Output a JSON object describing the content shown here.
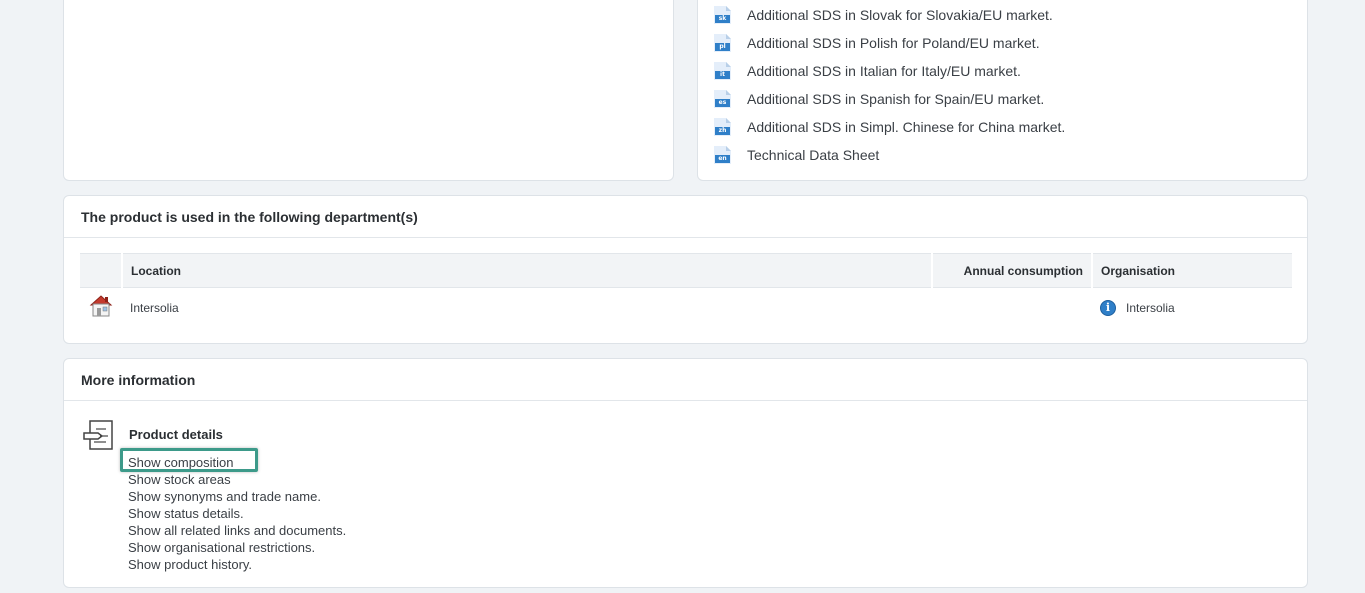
{
  "documents": [
    {
      "code": "sk",
      "label": "Additional SDS in Slovak for Slovakia/EU market."
    },
    {
      "code": "pl",
      "label": "Additional SDS in Polish for Poland/EU market."
    },
    {
      "code": "it",
      "label": "Additional SDS in Italian for Italy/EU market."
    },
    {
      "code": "es",
      "label": "Additional SDS in Spanish for Spain/EU market."
    },
    {
      "code": "zh",
      "label": "Additional SDS in Simpl. Chinese for China market."
    },
    {
      "code": "en",
      "label": "Technical Data Sheet"
    }
  ],
  "departments": {
    "title": "The product is used in the following department(s)",
    "columns": {
      "location": "Location",
      "annual_consumption": "Annual consumption",
      "organisation": "Organisation"
    },
    "rows": [
      {
        "location": "Intersolia",
        "annual_consumption": "",
        "organisation": "Intersolia"
      }
    ]
  },
  "more_info": {
    "title": "More information",
    "details_title": "Product details",
    "links": [
      "Show composition",
      "Show stock areas",
      "Show synonyms and trade name.",
      "Show status details.",
      "Show all related links and documents.",
      "Show organisational restrictions.",
      "Show product history."
    ]
  },
  "colors": {
    "highlight": "#3d9a8a",
    "file_tag": "#2f7fc8"
  },
  "icons": {
    "file": "document-file-icon",
    "house": "house-icon",
    "info": "info-icon",
    "product": "product-details-icon"
  }
}
